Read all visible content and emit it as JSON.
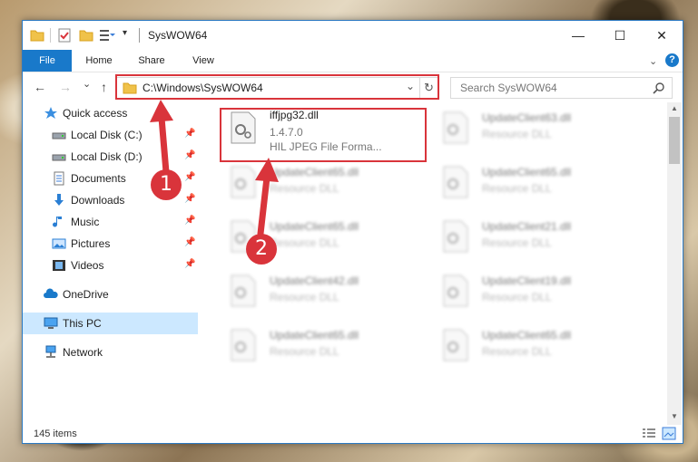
{
  "titlebar": {
    "title": "SysWOW64",
    "minimize": "—",
    "maximize": "☐",
    "close": "✕"
  },
  "ribbon": {
    "tabs": [
      "File",
      "Home",
      "Share",
      "View"
    ],
    "help": "?"
  },
  "navbar": {
    "back": "←",
    "forward": "→",
    "recent": "⌄",
    "up": "↑",
    "address": "C:\\Windows\\SysWOW64",
    "dropdown": "⌄",
    "refresh": "↻",
    "search_placeholder": "Search SysWOW64"
  },
  "sidebar": {
    "items": [
      {
        "label": "Quick access",
        "icon": "star-icon"
      },
      {
        "label": "Local Disk (C:)",
        "icon": "drive-icon"
      },
      {
        "label": "Local Disk (D:)",
        "icon": "drive-icon"
      },
      {
        "label": "Documents",
        "icon": "documents-icon"
      },
      {
        "label": "Downloads",
        "icon": "downloads-icon"
      },
      {
        "label": "Music",
        "icon": "music-icon"
      },
      {
        "label": "Pictures",
        "icon": "pictures-icon"
      },
      {
        "label": "Videos",
        "icon": "videos-icon"
      },
      {
        "label": "OneDrive",
        "icon": "cloud-icon"
      },
      {
        "label": "This PC",
        "icon": "computer-icon"
      },
      {
        "label": "Network",
        "icon": "network-icon"
      }
    ]
  },
  "files": [
    {
      "name": "iffjpg32.dll",
      "version": "1.4.7.0",
      "desc": "HIL JPEG File Forma..."
    },
    {
      "name": "UpdateClient63.dll",
      "desc": "Resource DLL"
    },
    {
      "name": "UpdateClient65.dll",
      "desc": "Resource DLL"
    },
    {
      "name": "UpdateClient65.dll",
      "desc": "Resource DLL"
    },
    {
      "name": "UpdateClient65.dll",
      "desc": "Resource DLL"
    },
    {
      "name": "UpdateClient21.dll",
      "desc": "Resource DLL"
    },
    {
      "name": "UpdateClient42.dll",
      "desc": "Resource DLL"
    },
    {
      "name": "UpdateClient19.dll",
      "desc": "Resource DLL"
    },
    {
      "name": "UpdateClient65.dll",
      "desc": "Resource DLL"
    },
    {
      "name": "UpdateClient65.dll",
      "desc": "Resource DLL"
    }
  ],
  "status": {
    "items": "145 items"
  },
  "markers": [
    "1",
    "2"
  ],
  "colors": {
    "accent": "#1979ca",
    "highlight": "#d9343b",
    "selected": "#cce8ff"
  }
}
